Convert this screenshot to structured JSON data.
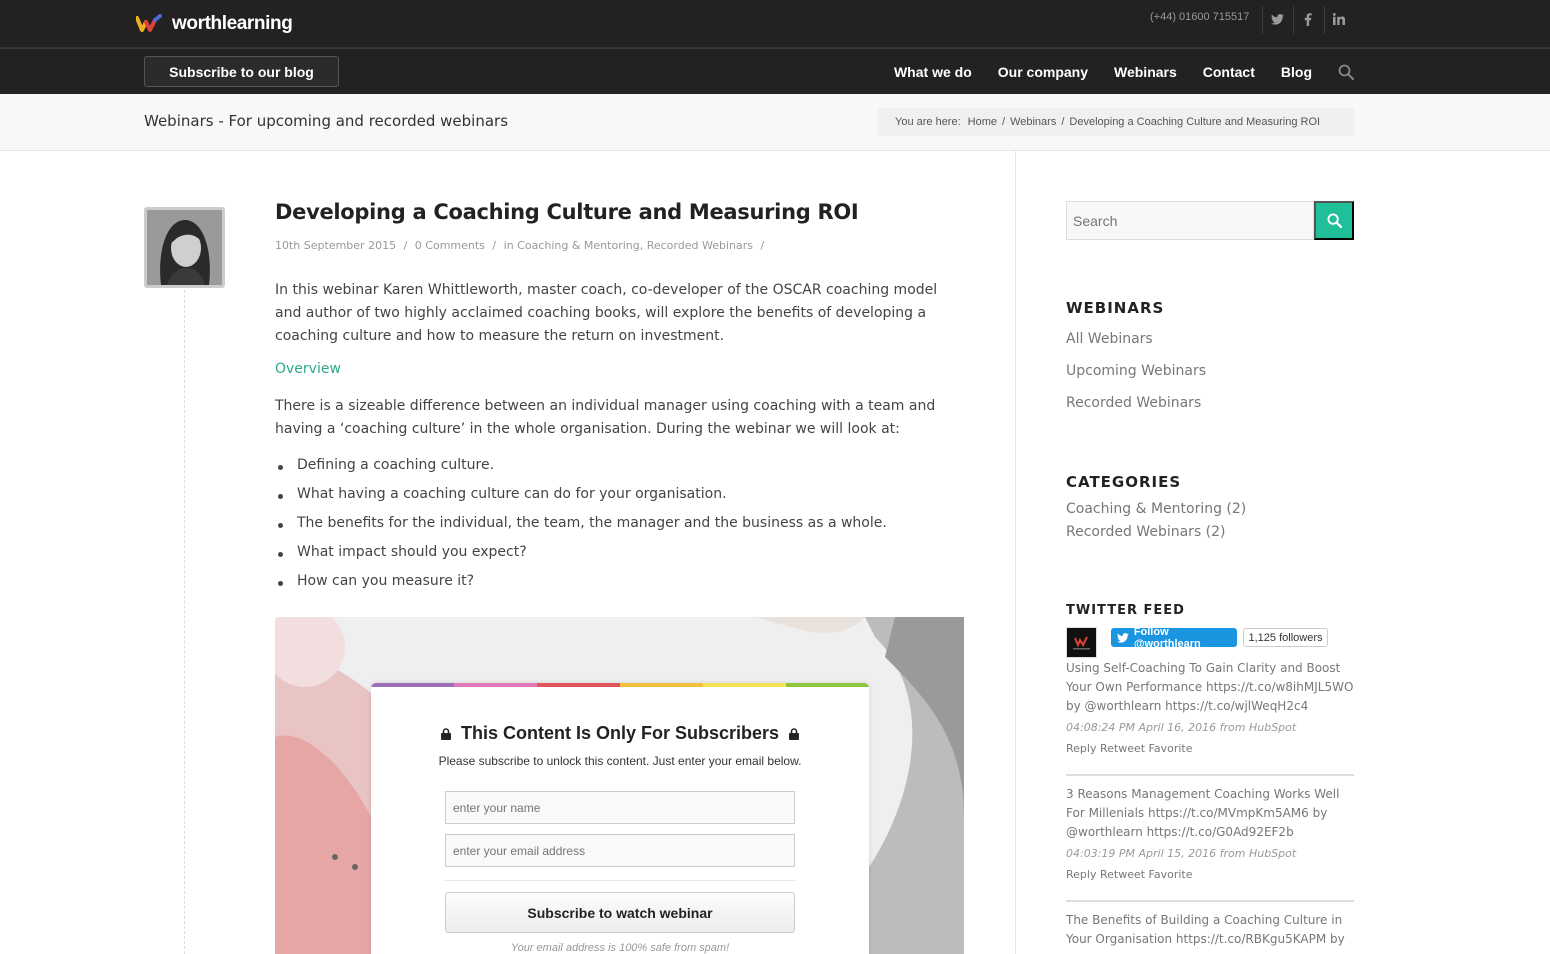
{
  "header": {
    "brand": "worthlearning",
    "phone": "(+44) 01600 715517",
    "subscribe_label": "Subscribe to our blog",
    "nav": [
      "What we do",
      "Our company",
      "Webinars",
      "Contact",
      "Blog"
    ]
  },
  "titlebar": {
    "title": "Webinars - For upcoming and recorded webinars",
    "breadcrumb": {
      "prefix": "You are here:",
      "items": [
        "Home",
        "Webinars",
        "Developing a Coaching Culture and Measuring ROI"
      ],
      "separator": "/"
    }
  },
  "post": {
    "title": "Developing a Coaching Culture and Measuring ROI",
    "date": "10th September 2015",
    "comments": "0 Comments",
    "in_label": "in",
    "categories": "Coaching & Mentoring, Recorded Webinars",
    "sep": "/",
    "intro": "In this webinar Karen Whittleworth, master coach, co-developer of the OSCAR coaching model and author of two highly acclaimed coaching books, will explore the benefits of developing a coaching culture and how to measure the return on investment.",
    "overview_heading": "Overview",
    "paragraph2": "There is a sizeable difference between an individual manager using coaching with a team and having a ‘coaching culture’ in the whole organisation. During the webinar we will look at:",
    "bullets": [
      "Defining a coaching culture.",
      "What having a coaching culture can do for your organisation.",
      "The benefits for the individual, the team, the manager and the business as a whole.",
      "What impact should you expect?",
      "How can you measure it?"
    ]
  },
  "subscribe_box": {
    "heading": "This Content Is Only For Subscribers",
    "description": "Please subscribe to unlock this content. Just enter your email below.",
    "name_placeholder": "enter your name",
    "email_placeholder": "enter your email address",
    "button": "Subscribe to watch webinar",
    "safe_note": "Your email address is 100% safe from spam!",
    "rainbow_colors": [
      "#9b6fb5",
      "#e07ab8",
      "#e0555a",
      "#f0c040",
      "#f5e05a",
      "#8ec63f"
    ]
  },
  "sidebar": {
    "search_placeholder": "Search",
    "webinars_title": "WEBINARS",
    "webinar_links": [
      "All Webinars",
      "Upcoming Webinars",
      "Recorded Webinars"
    ],
    "categories_title": "CATEGORIES",
    "category_links": [
      "Coaching & Mentoring (2)",
      "Recorded Webinars (2)"
    ],
    "twitter_title": "TWITTER FEED",
    "follow_label": "Follow @worthlearn",
    "followers": "1,125 followers",
    "tweets": [
      {
        "text": "Using Self-Coaching To Gain Clarity and Boost Your Own Performance https://t.co/w8ihMJL5WO by @worthlearn https://t.co/wjlWeqH2c4",
        "time": "04:08:24 PM April 16, 2016 from HubSpot",
        "actions": [
          "Reply",
          "Retweet",
          "Favorite"
        ]
      },
      {
        "text": "3 Reasons Management Coaching Works Well For Millenials https://t.co/MVmpKm5AM6 by @worthlearn https://t.co/G0Ad92EF2b",
        "time": "04:03:19 PM April 15, 2016 from HubSpot",
        "actions": [
          "Reply",
          "Retweet",
          "Favorite"
        ]
      },
      {
        "text": "The Benefits of Building a Coaching Culture in Your Organisation https://t.co/RBKgu5KAPM by"
      }
    ]
  },
  "colors": {
    "accent": "#1fbf99",
    "overview": "#2ba88b",
    "header_bg": "#222222",
    "twitter_blue": "#1b95e0"
  }
}
